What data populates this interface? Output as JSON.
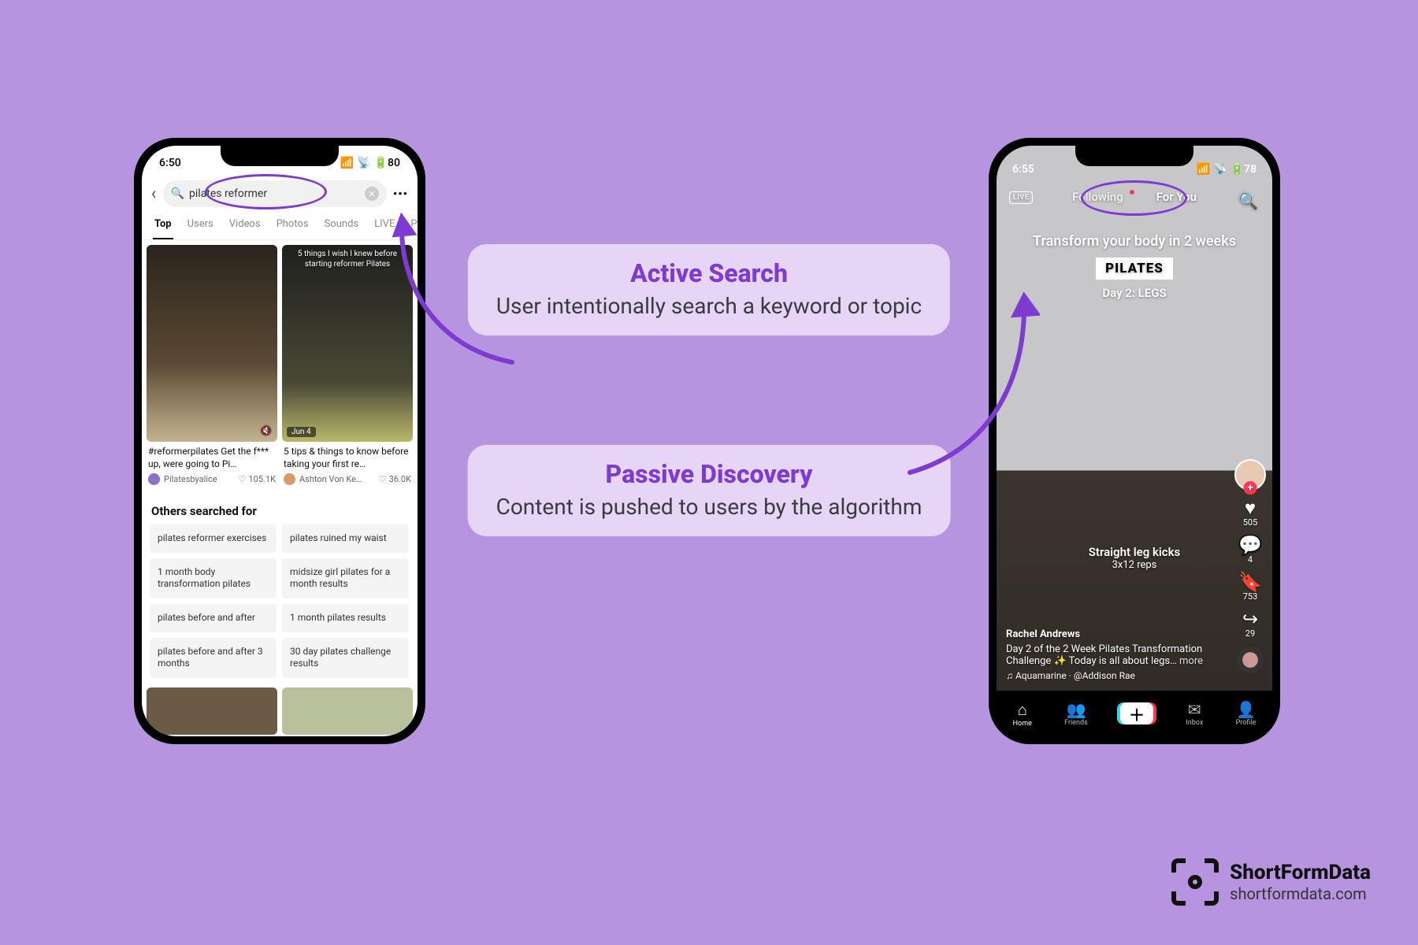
{
  "callouts": {
    "active": {
      "title": "Active Search",
      "body": "User intentionally search a keyword or topic"
    },
    "passive": {
      "title": "Passive Discovery",
      "body": "Content is pushed to users by the algorithm"
    }
  },
  "brand": {
    "name": "ShortFormData",
    "url": "shortformdata.com"
  },
  "left_phone": {
    "status": {
      "time": "6:50",
      "battery": "80"
    },
    "search_query": "pilates reformer",
    "tabs": [
      "Top",
      "Users",
      "Videos",
      "Photos",
      "Sounds",
      "LIVE",
      "Pl"
    ],
    "results": [
      {
        "overlay": "",
        "date": "",
        "title": "#reformerpilates Get the f*** up, were going to Pi…",
        "author": "Pilatesbyalice",
        "likes": "105.1K"
      },
      {
        "overlay": "5 things I wish I knew before starting reformer Pilates",
        "date": "Jun 4",
        "title": "5 tips & things to know before taking your first re…",
        "author": "Ashton Von Ke…",
        "likes": "36.0K"
      }
    ],
    "others_header": "Others searched for",
    "chips": [
      "pilates reformer exercises",
      "pilates ruined my waist",
      "1 month body transformation pilates",
      "midsize girl pilates for a month results",
      "pilates before and after",
      "1 month pilates results",
      "pilates before and after 3 months",
      "30 day pilates challenge results"
    ]
  },
  "right_phone": {
    "status": {
      "time": "6:55",
      "battery": "78"
    },
    "nav": {
      "following": "Following",
      "foryou": "For You",
      "live": "LIVE"
    },
    "overlay": {
      "headline": "Transform your body in 2 weeks",
      "pill": "PILATES",
      "sub": "Day 2: LEGS"
    },
    "exercise": {
      "name": "Straight leg kicks",
      "reps": "3x12 reps"
    },
    "rail": {
      "likes": "505",
      "comments": "4",
      "saves": "753",
      "shares": "29"
    },
    "caption": {
      "user": "Rachel Andrews",
      "text": "Day 2 of the 2 Week Pilates Transformation Challenge ✨ Today is all about legs…",
      "more": "more",
      "sound": "♫ Aquamarine · @Addison Rae"
    },
    "nav_items": [
      "Home",
      "Friends",
      "Inbox",
      "Profile"
    ]
  }
}
